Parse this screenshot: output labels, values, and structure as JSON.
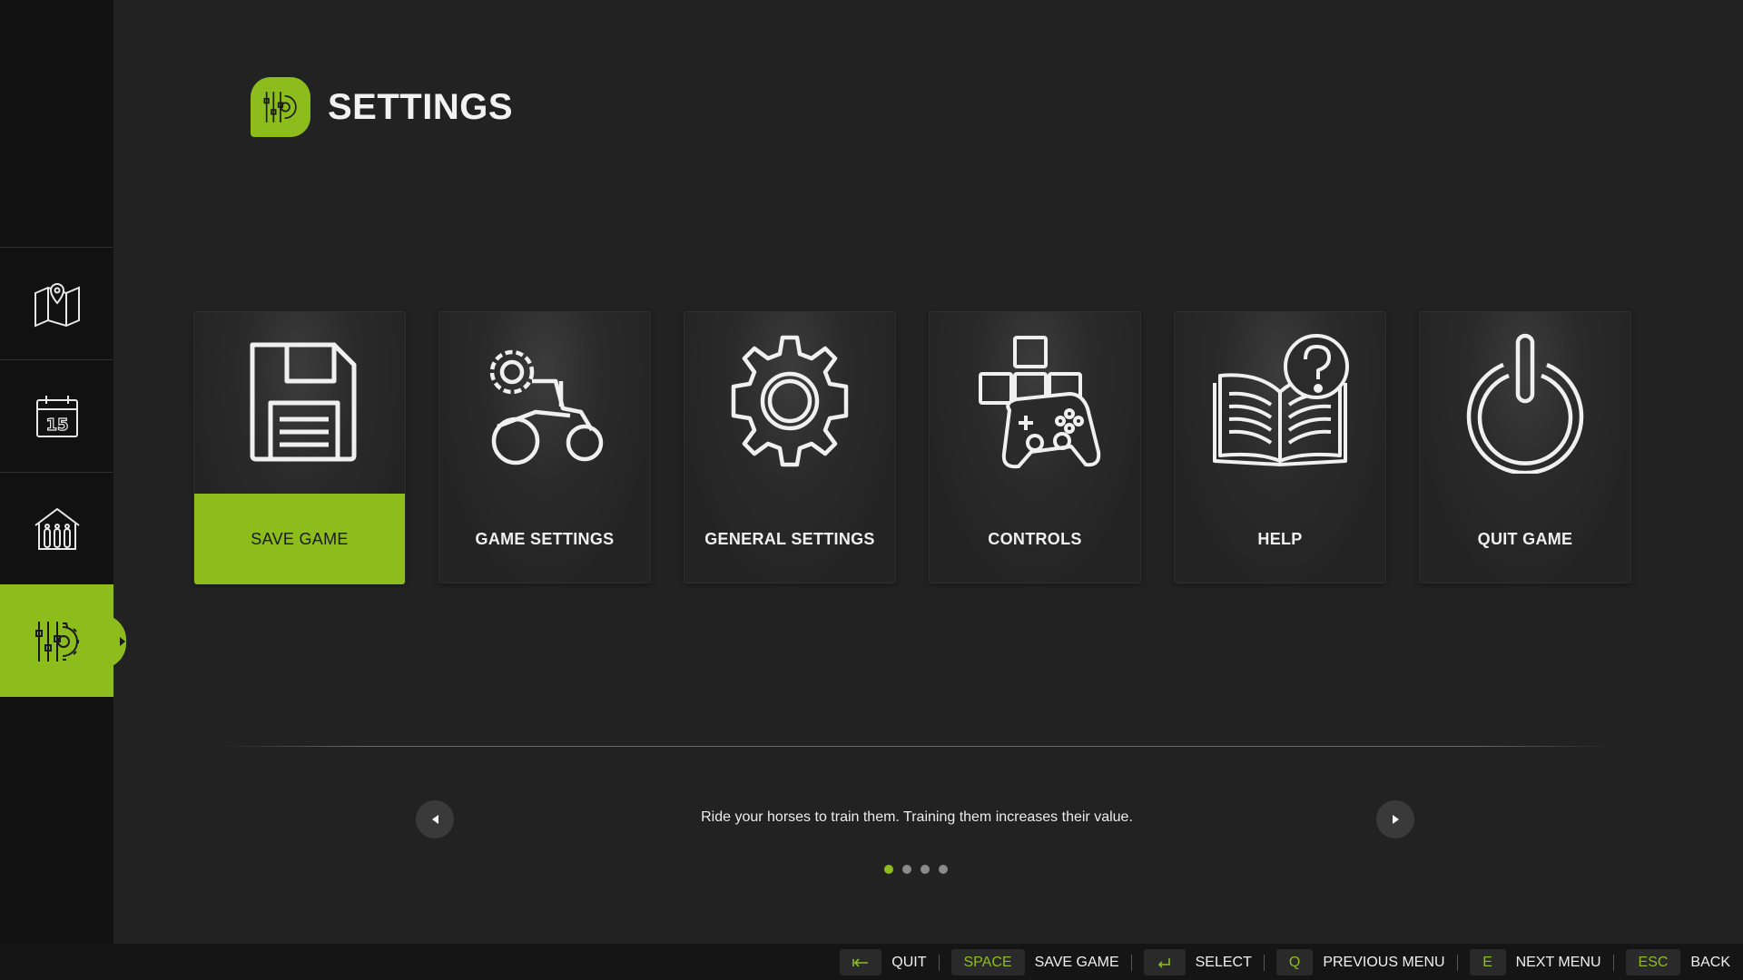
{
  "header": {
    "title": "SETTINGS",
    "icon": "settings-sliders-gear-icon"
  },
  "sidebar": {
    "items": [
      {
        "name": "map",
        "icon": "map-pin-icon",
        "active": false
      },
      {
        "name": "calendar",
        "icon": "calendar-icon",
        "day": "15",
        "active": false
      },
      {
        "name": "production",
        "icon": "barn-silo-icon",
        "active": false
      },
      {
        "name": "settings",
        "icon": "settings-sliders-gear-icon",
        "active": true
      }
    ]
  },
  "tiles": [
    {
      "label": "SAVE GAME",
      "icon": "floppy-disk-icon",
      "active": true
    },
    {
      "label": "GAME SETTINGS",
      "icon": "tractor-gear-icon",
      "active": false
    },
    {
      "label": "GENERAL SETTINGS",
      "icon": "gear-icon",
      "active": false
    },
    {
      "label": "CONTROLS",
      "icon": "gamepad-keys-icon",
      "active": false
    },
    {
      "label": "HELP",
      "icon": "book-question-icon",
      "active": false
    },
    {
      "label": "QUIT GAME",
      "icon": "power-icon",
      "active": false
    }
  ],
  "tip": {
    "text": "Ride your horses to train them. Training them increases their value.",
    "page_count": 4,
    "active_page": 1
  },
  "hints": [
    {
      "key": "",
      "key_icon": "backspace-icon",
      "label": "QUIT"
    },
    {
      "key": "SPACE",
      "label": "SAVE GAME"
    },
    {
      "key": "",
      "key_icon": "enter-icon",
      "label": "SELECT"
    },
    {
      "key": "Q",
      "label": "PREVIOUS MENU"
    },
    {
      "key": "E",
      "label": "NEXT MENU"
    },
    {
      "key": "ESC",
      "label": "BACK"
    }
  ],
  "colors": {
    "accent": "#8dbd1d",
    "background": "#222222",
    "sidebar": "#111111"
  }
}
